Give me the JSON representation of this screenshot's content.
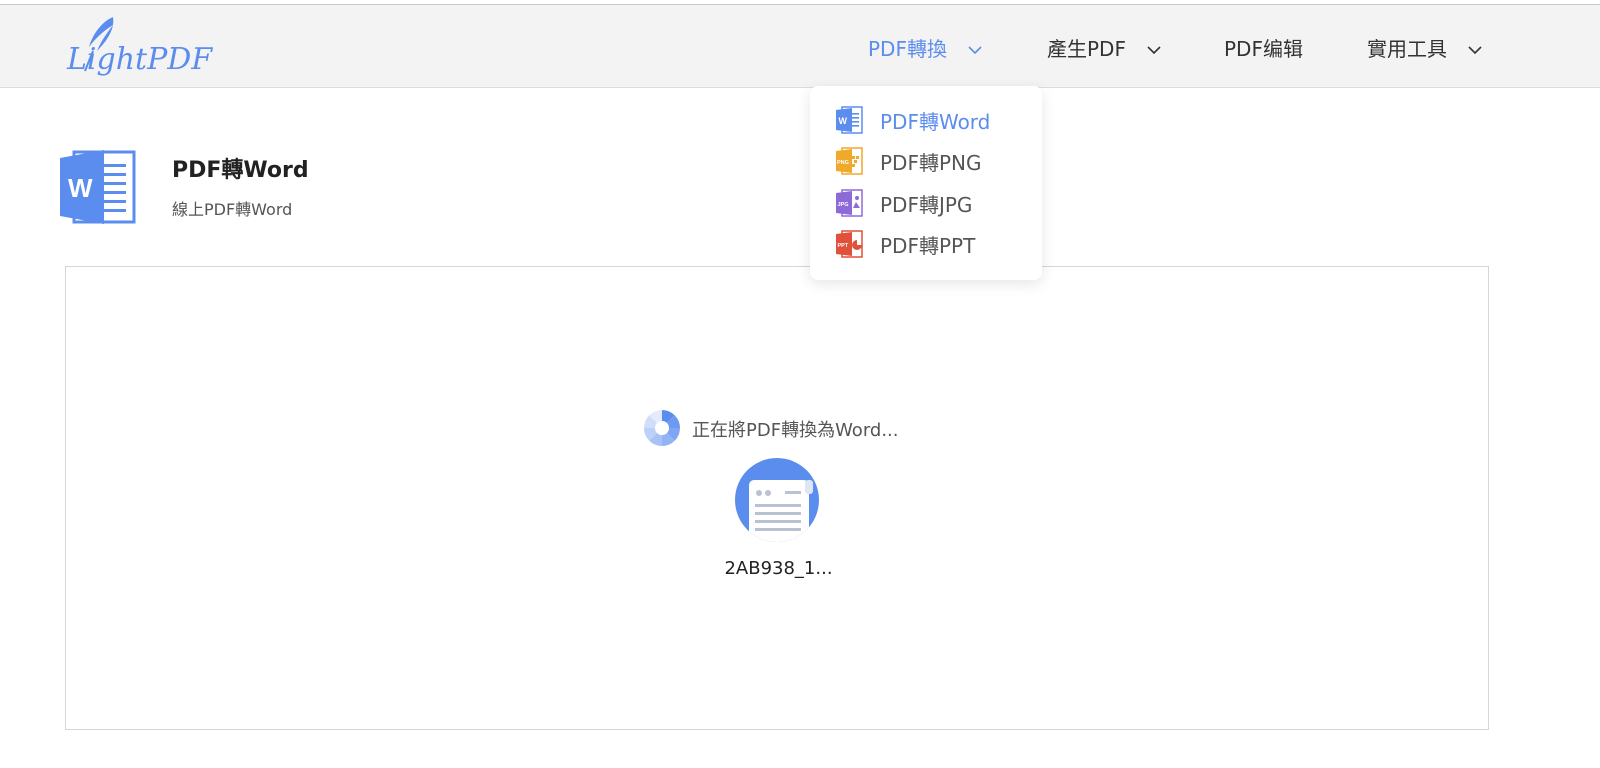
{
  "brand": {
    "logo_text": "LightPDF"
  },
  "nav": [
    {
      "label": "PDF轉換",
      "active": true,
      "has_menu": true
    },
    {
      "label": "產生PDF",
      "active": false,
      "has_menu": true
    },
    {
      "label": "PDF编辑",
      "active": false,
      "has_menu": false
    },
    {
      "label": "實用工具",
      "active": false,
      "has_menu": true
    }
  ],
  "dropdown": {
    "items": [
      {
        "label": "PDF轉Word",
        "icon": "word-file-icon",
        "color": "#5b8def",
        "active": true
      },
      {
        "label": "PDF轉PNG",
        "icon": "png-file-icon",
        "badge": "PNG",
        "color": "#f0a92a",
        "active": false
      },
      {
        "label": "PDF轉JPG",
        "icon": "jpg-file-icon",
        "badge": "JPG",
        "color": "#8e6ad8",
        "active": false
      },
      {
        "label": "PDF轉PPT",
        "icon": "ppt-file-icon",
        "badge": "PPT",
        "color": "#e0503a",
        "active": false
      }
    ]
  },
  "tool": {
    "title": "PDF轉Word",
    "subtitle": "線上PDF轉Word",
    "icon": "word-doc-icon",
    "color": "#5b8def"
  },
  "conversion": {
    "status": "正在將PDF轉換為Word...",
    "file_name": "2AB938_1..."
  },
  "colors": {
    "accent": "#5b8def",
    "header_bg": "#f3f3f3"
  }
}
